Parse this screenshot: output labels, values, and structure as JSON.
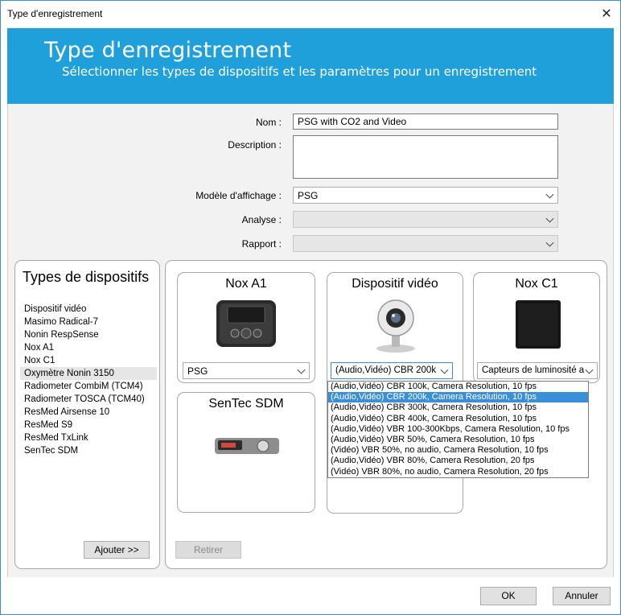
{
  "window": {
    "title": "Type d'enregistrement",
    "close_label": "✕"
  },
  "banner": {
    "title": "Type d'enregistrement",
    "subtitle": "Sélectionner les types de dispositifs et les paramètres pour un enregistrement"
  },
  "form": {
    "nom_label": "Nom :",
    "nom_value": "PSG with CO2 and Video",
    "description_label": "Description :",
    "description_value": "",
    "modele_label": "Modèle d'affichage :",
    "modele_value": "PSG",
    "analyse_label": "Analyse :",
    "analyse_value": "",
    "rapport_label": "Rapport :",
    "rapport_value": ""
  },
  "device_types": {
    "title": "Types de dispositifs",
    "items": [
      "Dispositif vidéo",
      "Masimo Radical-7",
      "Nonin RespSense",
      "Nox A1",
      "Nox C1",
      "Oxymètre Nonin 3150",
      "Radiometer CombiM (TCM4)",
      "Radiometer TOSCA (TCM40)",
      "ResMed Airsense 10",
      "ResMed S9",
      "ResMed TxLink",
      "SenTec SDM"
    ],
    "selected_index": 5,
    "add_button": "Ajouter >>"
  },
  "selected_devices": {
    "remove_button": "Retirer",
    "cards": [
      {
        "title": "Nox A1",
        "combo": "PSG"
      },
      {
        "title": "Dispositif vidéo",
        "combo": "(Audio,Vidéo) CBR 200k"
      },
      {
        "title": "Nox C1",
        "combo": "Capteurs de luminosité a"
      },
      {
        "title": "SenTec SDM"
      }
    ]
  },
  "video_dropdown": {
    "highlighted_index": 1,
    "options": [
      "(Audio,Vidéo) CBR 100k, Camera Resolution, 10 fps",
      "(Audio,Vidéo) CBR 200k, Camera Resolution, 10 fps",
      "(Audio,Vidéo) CBR 300k, Camera Resolution, 10 fps",
      "(Audio,Vidéo) CBR 400k, Camera Resolution, 10 fps",
      "(Audio,Vidéo) VBR 100-300Kbps, Camera Resolution, 10 fps",
      "(Audio,Vidéo) VBR 50%, Camera Resolution, 10 fps",
      "(Vidéo) VBR 50%, no audio, Camera Resolution, 10 fps",
      "(Audio,Vidéo) VBR 80%, Camera Resolution, 20 fps",
      "(Vidéo) VBR 80%, no audio, Camera Resolution, 20 fps"
    ]
  },
  "footer": {
    "ok": "OK",
    "cancel": "Annuler"
  },
  "colors": {
    "banner": "#1fa0da",
    "highlight": "#3a8fd6"
  }
}
